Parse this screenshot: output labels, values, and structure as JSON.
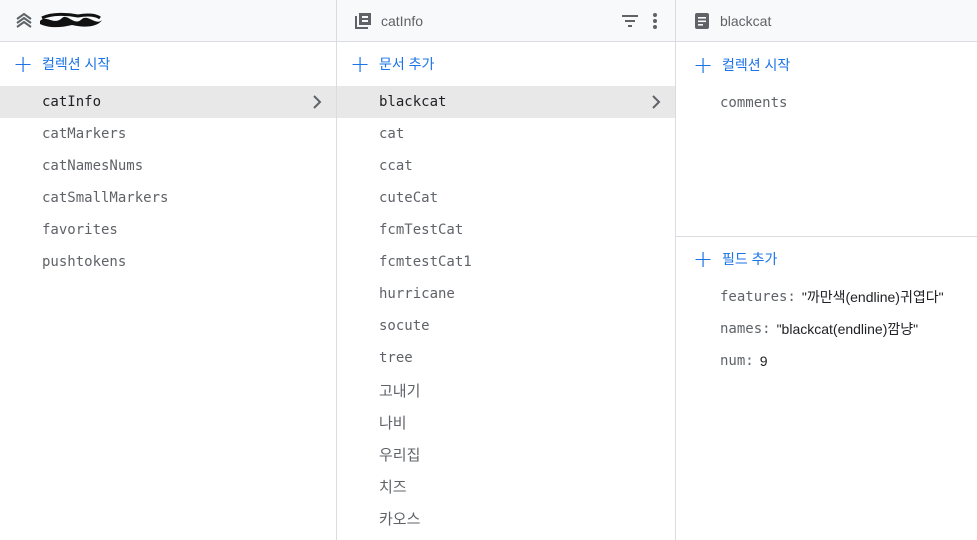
{
  "colors": {
    "accent": "#1a73e8",
    "header_bg": "#f8f9fa",
    "selected_bg": "#e8e8e8",
    "divider": "#dadce0"
  },
  "col1": {
    "header": {
      "icon": "firestore-layers-icon",
      "title_redacted": true
    },
    "add_label": "컬렉션 시작",
    "items": [
      {
        "label": "catInfo",
        "selected": true
      },
      {
        "label": "catMarkers"
      },
      {
        "label": "catNamesNums"
      },
      {
        "label": "catSmallMarkers"
      },
      {
        "label": "favorites"
      },
      {
        "label": "pushtokens"
      }
    ]
  },
  "col2": {
    "header": {
      "icon": "collection-icon",
      "title": "catInfo",
      "filter_icon": "filter-icon",
      "menu_icon": "more-vert-icon"
    },
    "add_label": "문서 추가",
    "items": [
      {
        "label": "blackcat",
        "selected": true
      },
      {
        "label": "cat"
      },
      {
        "label": "ccat"
      },
      {
        "label": "cuteCat"
      },
      {
        "label": "fcmTestCat"
      },
      {
        "label": "fcmtestCat1"
      },
      {
        "label": "hurricane"
      },
      {
        "label": "socute"
      },
      {
        "label": "tree"
      },
      {
        "label": "고내기"
      },
      {
        "label": "나비"
      },
      {
        "label": "우리집"
      },
      {
        "label": "치즈"
      },
      {
        "label": "카오스"
      }
    ]
  },
  "col3": {
    "header": {
      "icon": "document-icon",
      "title": "blackcat"
    },
    "add_collection_label": "컬렉션 시작",
    "subcollections": [
      {
        "label": "comments"
      }
    ],
    "add_field_label": "필드 추가",
    "fields": [
      {
        "key": "features:",
        "value": "\"까만색(endline)귀엽다\""
      },
      {
        "key": "names:",
        "value": "\"blackcat(endline)깜냥\""
      },
      {
        "key": "num:",
        "value": "9"
      }
    ]
  }
}
